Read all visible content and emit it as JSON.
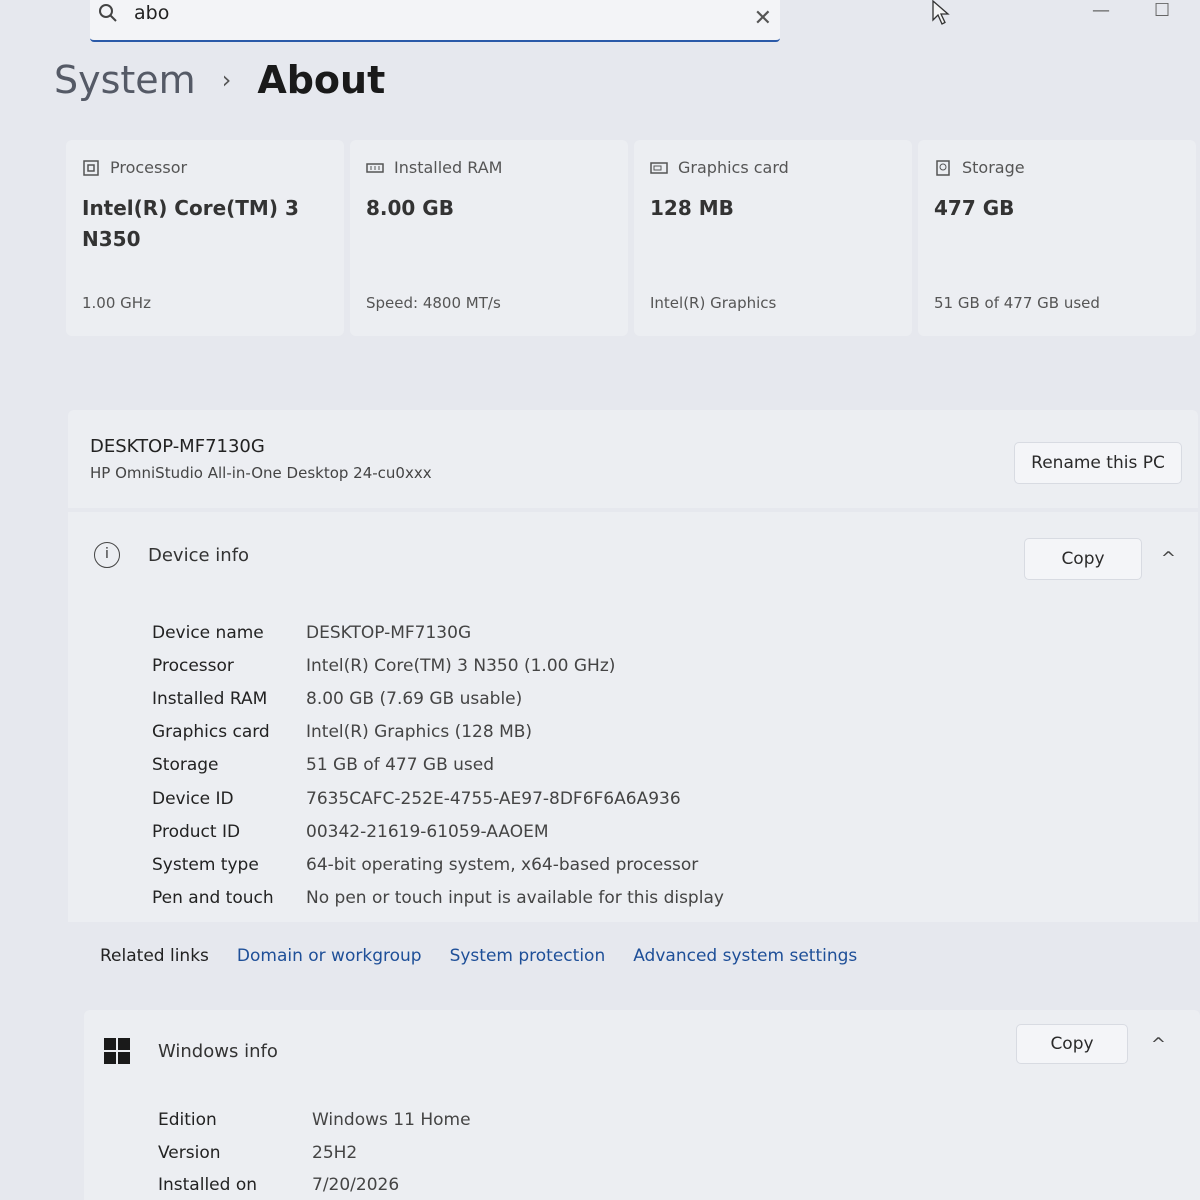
{
  "search": {
    "value": "abo",
    "clear_glyph": "✕"
  },
  "window_controls": {
    "minimize": "—",
    "maximize": "☐"
  },
  "breadcrumb": {
    "section": "System",
    "separator": "›",
    "page": "About"
  },
  "cards": [
    {
      "label": "Processor",
      "value": "Intel(R) Core(TM) 3 N350",
      "sub": "1.00 GHz",
      "icon": "processor-icon"
    },
    {
      "label": "Installed RAM",
      "value": "8.00 GB",
      "sub": "Speed: 4800 MT/s",
      "icon": "ram-icon"
    },
    {
      "label": "Graphics card",
      "value": "128 MB",
      "sub": "Intel(R) Graphics",
      "icon": "graphics-card-icon"
    },
    {
      "label": "Storage",
      "value": "477 GB",
      "sub": "51 GB of 477 GB used",
      "icon": "storage-icon"
    }
  ],
  "pc": {
    "name": "DESKTOP-MF7130G",
    "model": "HP OmniStudio All-in-One Desktop 24-cu0xxx",
    "rename_label": "Rename this PC"
  },
  "device_info": {
    "title": "Device info",
    "icon_glyph": "i",
    "copy_label": "Copy",
    "caret": "^",
    "rows": [
      {
        "k": "Device name",
        "v": "DESKTOP-MF7130G"
      },
      {
        "k": "Processor",
        "v": "Intel(R) Core(TM) 3 N350 (1.00 GHz)"
      },
      {
        "k": "Installed RAM",
        "v": "8.00 GB (7.69 GB usable)"
      },
      {
        "k": "Graphics card",
        "v": "Intel(R) Graphics (128 MB)"
      },
      {
        "k": "Storage",
        "v": "51 GB of 477 GB used"
      },
      {
        "k": "Device ID",
        "v": "7635CAFC-252E-4755-AE97-8DF6F6A6A936"
      },
      {
        "k": "Product ID",
        "v": "00342-21619-61059-AAOEM"
      },
      {
        "k": "System type",
        "v": "64-bit operating system, x64-based processor"
      },
      {
        "k": "Pen and touch",
        "v": "No pen or touch input is available for this display"
      }
    ]
  },
  "related": {
    "label": "Related links",
    "links": [
      "Domain or workgroup",
      "System protection",
      "Advanced system settings"
    ]
  },
  "windows_info": {
    "title": "Windows info",
    "copy_label": "Copy",
    "caret": "^",
    "rows": [
      {
        "k": "Edition",
        "v": "Windows 11 Home"
      },
      {
        "k": "Version",
        "v": "25H2"
      },
      {
        "k": "Installed on",
        "v": "7/20/2026"
      }
    ]
  }
}
